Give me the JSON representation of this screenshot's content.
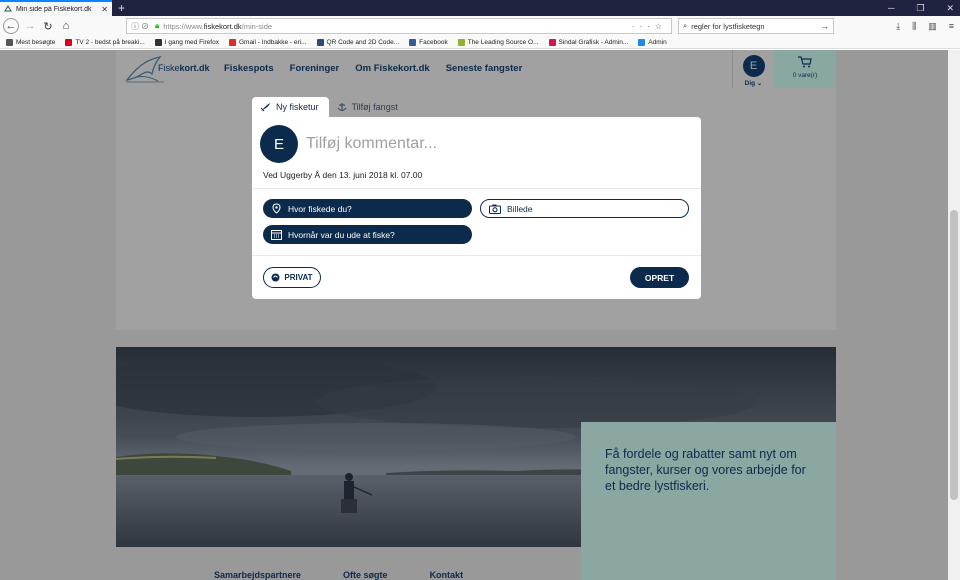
{
  "browser": {
    "tab_title": "Min side på Fiskekort.dk",
    "url_prefix": "https://www.",
    "url_domain": "fiskekort.dk",
    "url_path": "/min-side",
    "search_value": "regler for lystfisketegn",
    "bookmarks": [
      {
        "label": "Mest besøgte",
        "color": "#555"
      },
      {
        "label": "TV 2 - bedst på breaki...",
        "color": "#d6001c"
      },
      {
        "label": "I gang med Firefox",
        "color": "#333"
      },
      {
        "label": "Gmail - Indbakke - eri...",
        "color": "#d93025"
      },
      {
        "label": "QR Code and 2D Code...",
        "color": "#2a4a7a"
      },
      {
        "label": "Facebook",
        "color": "#3b5998"
      },
      {
        "label": "The Leading Source O...",
        "color": "#8fb32e"
      },
      {
        "label": "Sindal Grafisk - Admin...",
        "color": "#d4145a"
      },
      {
        "label": "Admin",
        "color": "#1e88e5"
      }
    ]
  },
  "site": {
    "logo_prefix": "Fiske",
    "logo_suffix": "kort.dk",
    "nav": [
      "Fiskespots",
      "Foreninger",
      "Om Fiskekort.dk",
      "Seneste fangster"
    ],
    "user_initial": "E",
    "user_label": "Dig",
    "cart_label": "0 vare(r)",
    "brand_color": "#0c2a4c",
    "accent_color": "#8aa7a1"
  },
  "modal": {
    "tabs": [
      {
        "label": "Ny fisketur",
        "icon": "fish-icon"
      },
      {
        "label": "Tilføj fangst",
        "icon": "anchor-icon"
      }
    ],
    "avatar_initial": "E",
    "comment_placeholder": "Tilføj kommentar...",
    "meta": "Ved Uggerby Å den 13. juni 2018 kl. 07.00",
    "where_label": "Hvor fiskede du?",
    "image_label": "Billede",
    "when_label": "Hvornår var du ude at fiske?",
    "privacy_label": "PRIVAT",
    "publish_label": "OPRET"
  },
  "promo": {
    "text": "Få fordele og rabatter samt nyt om fangster, kurser og vores arbejde for et bedre lystfiskeri."
  },
  "footer": {
    "columns": [
      "Samarbejdspartnere",
      "Ofte søgte",
      "Kontakt"
    ]
  }
}
